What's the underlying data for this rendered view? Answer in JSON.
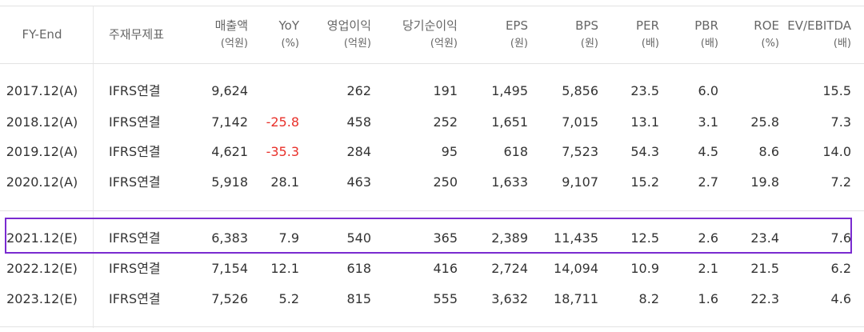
{
  "columns": [
    {
      "key": "fy",
      "label": "FY-End",
      "unit": ""
    },
    {
      "key": "stmt",
      "label": "주재무제표",
      "unit": ""
    },
    {
      "key": "sales",
      "label": "매출액",
      "unit": "(억원)"
    },
    {
      "key": "yoy",
      "label": "YoY",
      "unit": "(%)"
    },
    {
      "key": "op",
      "label": "영업이익",
      "unit": "(억원)"
    },
    {
      "key": "net",
      "label": "당기순이익",
      "unit": "(억원)"
    },
    {
      "key": "eps",
      "label": "EPS",
      "unit": "(원)"
    },
    {
      "key": "bps",
      "label": "BPS",
      "unit": "(원)"
    },
    {
      "key": "per",
      "label": "PER",
      "unit": "(배)"
    },
    {
      "key": "pbr",
      "label": "PBR",
      "unit": "(배)"
    },
    {
      "key": "roe",
      "label": "ROE",
      "unit": "(%)"
    },
    {
      "key": "ev",
      "label": "EV/EBITDA",
      "unit": "(배)"
    }
  ],
  "actual_rows": [
    {
      "fy": "2017.12(A)",
      "stmt": "IFRS연결",
      "sales": "9,624",
      "yoy": "",
      "op": "262",
      "net": "191",
      "eps": "1,495",
      "bps": "5,856",
      "per": "23.5",
      "pbr": "6.0",
      "roe": "",
      "ev": "15.5"
    },
    {
      "fy": "2018.12(A)",
      "stmt": "IFRS연결",
      "sales": "7,142",
      "yoy": "-25.8",
      "op": "458",
      "net": "252",
      "eps": "1,651",
      "bps": "7,015",
      "per": "13.1",
      "pbr": "3.1",
      "roe": "25.8",
      "ev": "7.3"
    },
    {
      "fy": "2019.12(A)",
      "stmt": "IFRS연결",
      "sales": "4,621",
      "yoy": "-35.3",
      "op": "284",
      "net": "95",
      "eps": "618",
      "bps": "7,523",
      "per": "54.3",
      "pbr": "4.5",
      "roe": "8.6",
      "ev": "14.0"
    },
    {
      "fy": "2020.12(A)",
      "stmt": "IFRS연결",
      "sales": "5,918",
      "yoy": "28.1",
      "op": "463",
      "net": "250",
      "eps": "1,633",
      "bps": "9,107",
      "per": "15.2",
      "pbr": "2.7",
      "roe": "19.8",
      "ev": "7.2"
    }
  ],
  "estimate_rows": [
    {
      "fy": "2021.12(E)",
      "stmt": "IFRS연결",
      "sales": "6,383",
      "yoy": "7.9",
      "op": "540",
      "net": "365",
      "eps": "2,389",
      "bps": "11,435",
      "per": "12.5",
      "pbr": "2.6",
      "roe": "23.4",
      "ev": "7.6"
    },
    {
      "fy": "2022.12(E)",
      "stmt": "IFRS연결",
      "sales": "7,154",
      "yoy": "12.1",
      "op": "618",
      "net": "416",
      "eps": "2,724",
      "bps": "14,094",
      "per": "10.9",
      "pbr": "2.1",
      "roe": "21.5",
      "ev": "6.2"
    },
    {
      "fy": "2023.12(E)",
      "stmt": "IFRS연결",
      "sales": "7,526",
      "yoy": "5.2",
      "op": "815",
      "net": "555",
      "eps": "3,632",
      "bps": "18,711",
      "per": "8.2",
      "pbr": "1.6",
      "roe": "22.3",
      "ev": "4.6"
    }
  ],
  "colors": {
    "negative": "#e8302a",
    "highlight": "#7a2bd0",
    "text": "#333333",
    "header_text": "#666666"
  }
}
